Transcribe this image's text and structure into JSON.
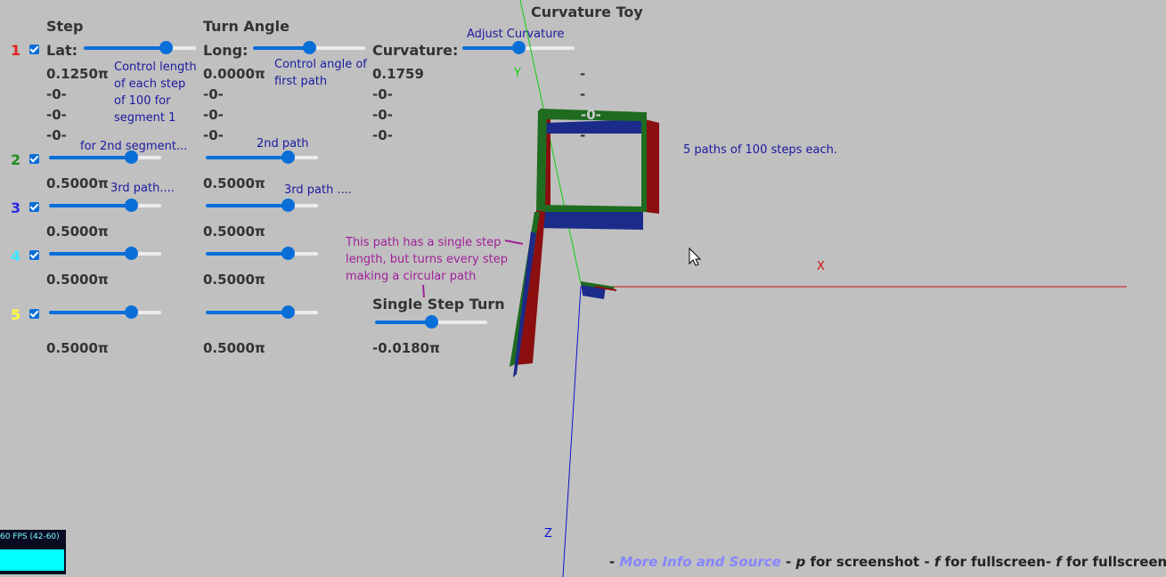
{
  "title": "Curvature Toy",
  "headers": {
    "step": "Step",
    "turn_angle": "Turn Angle"
  },
  "row1": {
    "num": "1",
    "num_color": "#e22020",
    "lat_label": "Lat:",
    "long_label": "Long:",
    "curv_label": "Curvature:",
    "lat_value": "0.1250π",
    "long_value": "0.0000π",
    "curv_value": "0.1759",
    "lat_slider": 0.73,
    "long_slider": 0.5,
    "curv_slider": 0.5,
    "sub_lat": [
      "-0-",
      "-0-",
      "-0-"
    ],
    "sub_long": [
      "-0-",
      "-0-",
      "-0-"
    ],
    "sub_curv": [
      "-0-",
      "-0-",
      "-0-"
    ],
    "sub_dash": [
      "-",
      "-",
      "-",
      "-"
    ]
  },
  "rows": [
    {
      "num": "2",
      "num_color": "#1f8f1f",
      "step_value": "0.5000π",
      "turn_value": "0.5000π",
      "step_slider": 0.73,
      "turn_slider": 0.73
    },
    {
      "num": "3",
      "num_color": "#2b2be0",
      "step_value": "0.5000π",
      "turn_value": "0.5000π",
      "step_slider": 0.73,
      "turn_slider": 0.73
    },
    {
      "num": "4",
      "num_color": "#40e8ff",
      "step_value": "0.5000π",
      "turn_value": "0.5000π",
      "step_slider": 0.73,
      "turn_slider": 0.73
    },
    {
      "num": "5",
      "num_color": "#ffff40",
      "step_value": "0.5000π",
      "turn_value": "0.5000π",
      "step_slider": 0.73,
      "turn_slider": 0.73
    }
  ],
  "single_step": {
    "label": "Single Step Turn",
    "value": "-0.0180π",
    "slider": 0.5
  },
  "notes": {
    "adjust_curvature": "Adjust Curvature",
    "control_length": [
      "Control length",
      "of each step",
      "of 100 for",
      "segment 1"
    ],
    "control_angle": [
      "Control angle of",
      "first path"
    ],
    "second_segment": "for 2nd segment...",
    "second_path": "2nd path",
    "third_path_a": "3rd path....",
    "third_path_b": "3rd path ....",
    "five_paths": "5 paths of 100 steps each.",
    "circular": [
      "This path has a single step",
      "length, but turns every step",
      "making a circular path"
    ],
    "zero_marker": "-0-"
  },
  "axes": {
    "x": "X",
    "y": "Y",
    "z": "Z",
    "x_color": "#cc1111",
    "y_color": "#11cc11",
    "z_color": "#1111cc"
  },
  "fps": {
    "text": "60 FPS (42-60)"
  },
  "footer": {
    "dash1": "- ",
    "link": "More Info and Source",
    "dash2": " - ",
    "key_p": "p",
    "screenshot": " for screenshot - ",
    "key_f1": "f",
    "fullscreen1": " for fullscreen- ",
    "key_f2": "f",
    "fullscreen2": " for fullscreen"
  },
  "colors": {
    "background": "#c0c0c0",
    "accent": "#0a6ed8",
    "note_blue": "#1a1aa0",
    "note_magenta": "#a0209a"
  }
}
